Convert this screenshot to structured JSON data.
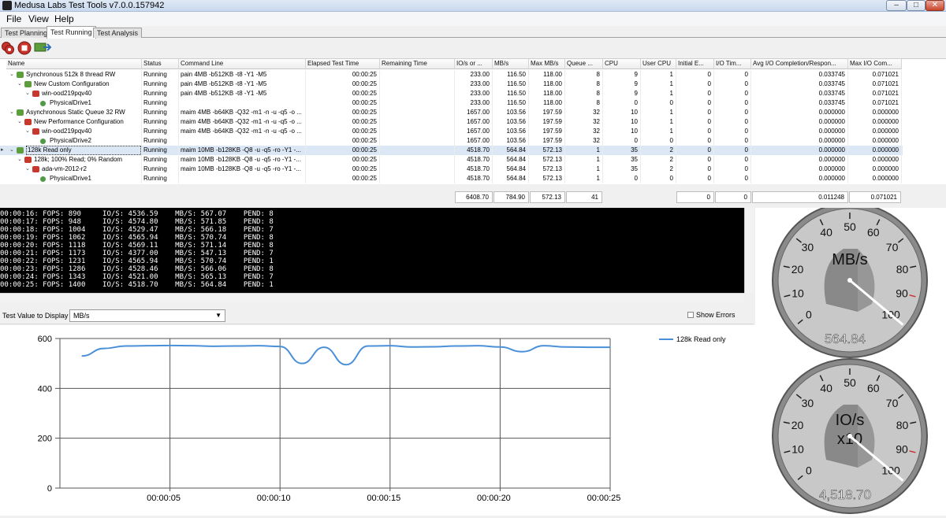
{
  "window": {
    "title": "Medusa Labs Test Tools v7.0.0.157942",
    "minimize": "–",
    "maximize": "□",
    "close": "✕"
  },
  "menu": [
    "File",
    "View",
    "Help"
  ],
  "tabs": [
    "Test Planning",
    "Test Running",
    "Test Analysis"
  ],
  "toolbar": {
    "icons": [
      "run-tests-icon",
      "stop-icon",
      "export-icon"
    ]
  },
  "grid": {
    "columns": [
      "Name",
      "Status",
      "Command Line",
      "Elapsed Test Time",
      "Remaining Time",
      "IO/s or ...",
      "MB/s",
      "Max MB/s",
      "Queue ...",
      "CPU",
      "User CPU",
      "Initial E...",
      "I/O Tim...",
      "Avg I/O Completion/Respon...",
      "Max I/O Com..."
    ],
    "rows": [
      {
        "level": 0,
        "exp": "⌄",
        "icon": "green",
        "name": "Synchronous 512k 8 thread RW",
        "status": "Running",
        "cmd": "pain 4MB -b512KB -t8 -Y1 -M5",
        "elapsed": "00:00:25",
        "remaining": "",
        "ios": "233.00",
        "mbs": "116.50",
        "maxmbs": "118.00",
        "queue": "8",
        "cpu": "9",
        "ucpu": "1",
        "init": "0",
        "iot": "0",
        "avg": "0.033745",
        "max": "0.071021"
      },
      {
        "level": 1,
        "exp": "⌄",
        "icon": "green",
        "name": "New Custom Configuration",
        "status": "Running",
        "cmd": "pain 4MB -b512KB -t8 -Y1 -M5",
        "elapsed": "00:00:25",
        "remaining": "",
        "ios": "233.00",
        "mbs": "116.50",
        "maxmbs": "118.00",
        "queue": "8",
        "cpu": "9",
        "ucpu": "1",
        "init": "0",
        "iot": "0",
        "avg": "0.033745",
        "max": "0.071021"
      },
      {
        "level": 2,
        "exp": "⌄",
        "icon": "red",
        "name": "win-ood219pqv40",
        "status": "Running",
        "cmd": "pain 4MB -b512KB -t8 -Y1 -M5",
        "elapsed": "00:00:25",
        "remaining": "",
        "ios": "233.00",
        "mbs": "116.50",
        "maxmbs": "118.00",
        "queue": "8",
        "cpu": "9",
        "ucpu": "1",
        "init": "0",
        "iot": "0",
        "avg": "0.033745",
        "max": "0.071021"
      },
      {
        "level": 3,
        "exp": "",
        "icon": "drive",
        "name": "PhysicalDrive1",
        "status": "Running",
        "cmd": "",
        "elapsed": "00:00:25",
        "remaining": "",
        "ios": "233.00",
        "mbs": "116.50",
        "maxmbs": "118.00",
        "queue": "8",
        "cpu": "0",
        "ucpu": "0",
        "init": "0",
        "iot": "0",
        "avg": "0.033745",
        "max": "0.071021"
      },
      {
        "level": 0,
        "exp": "⌄",
        "icon": "green",
        "name": "Asynchronous Static Queue 32 RW",
        "status": "Running",
        "cmd": "maim 4MB -b64KB -Q32 -m1 -n -u -q5 -o ...",
        "elapsed": "00:00:25",
        "remaining": "",
        "ios": "1657.00",
        "mbs": "103.56",
        "maxmbs": "197.59",
        "queue": "32",
        "cpu": "10",
        "ucpu": "1",
        "init": "0",
        "iot": "0",
        "avg": "0.000000",
        "max": "0.000000"
      },
      {
        "level": 1,
        "exp": "⌄",
        "icon": "red",
        "name": "New Performance Configuration",
        "status": "Running",
        "cmd": "maim 4MB -b64KB -Q32 -m1 -n -u -q5 -o ...",
        "elapsed": "00:00:25",
        "remaining": "",
        "ios": "1657.00",
        "mbs": "103.56",
        "maxmbs": "197.59",
        "queue": "32",
        "cpu": "10",
        "ucpu": "1",
        "init": "0",
        "iot": "0",
        "avg": "0.000000",
        "max": "0.000000"
      },
      {
        "level": 2,
        "exp": "⌄",
        "icon": "red",
        "name": "win-ood219pqv40",
        "status": "Running",
        "cmd": "maim 4MB -b64KB -Q32 -m1 -n -u -q5 -o ...",
        "elapsed": "00:00:25",
        "remaining": "",
        "ios": "1657.00",
        "mbs": "103.56",
        "maxmbs": "197.59",
        "queue": "32",
        "cpu": "10",
        "ucpu": "1",
        "init": "0",
        "iot": "0",
        "avg": "0.000000",
        "max": "0.000000"
      },
      {
        "level": 3,
        "exp": "",
        "icon": "drive",
        "name": "PhysicalDrive2",
        "status": "Running",
        "cmd": "",
        "elapsed": "00:00:25",
        "remaining": "",
        "ios": "1657.00",
        "mbs": "103.56",
        "maxmbs": "197.59",
        "queue": "32",
        "cpu": "0",
        "ucpu": "0",
        "init": "0",
        "iot": "0",
        "avg": "0.000000",
        "max": "0.000000"
      },
      {
        "level": 0,
        "exp": "⌄",
        "icon": "green",
        "name": "128k Read only",
        "status": "Running",
        "cmd": "maim 10MB -b128KB -Q8 -u -q5 -ro -Y1 -...",
        "elapsed": "00:00:25",
        "remaining": "",
        "ios": "4518.70",
        "mbs": "564.84",
        "maxmbs": "572.13",
        "queue": "1",
        "cpu": "35",
        "ucpu": "2",
        "init": "0",
        "iot": "0",
        "avg": "0.000000",
        "max": "0.000000",
        "selected": true
      },
      {
        "level": 1,
        "exp": "⌄",
        "icon": "red",
        "name": "128k; 100% Read; 0% Random",
        "status": "Running",
        "cmd": "maim 10MB -b128KB -Q8 -u -q5 -ro -Y1 -...",
        "elapsed": "00:00:25",
        "remaining": "",
        "ios": "4518.70",
        "mbs": "564.84",
        "maxmbs": "572.13",
        "queue": "1",
        "cpu": "35",
        "ucpu": "2",
        "init": "0",
        "iot": "0",
        "avg": "0.000000",
        "max": "0.000000"
      },
      {
        "level": 2,
        "exp": "⌄",
        "icon": "red",
        "name": "ada-vm-2012-r2",
        "status": "Running",
        "cmd": "maim 10MB -b128KB -Q8 -u -q5 -ro -Y1 -...",
        "elapsed": "00:00:25",
        "remaining": "",
        "ios": "4518.70",
        "mbs": "564.84",
        "maxmbs": "572.13",
        "queue": "1",
        "cpu": "35",
        "ucpu": "2",
        "init": "0",
        "iot": "0",
        "avg": "0.000000",
        "max": "0.000000"
      },
      {
        "level": 3,
        "exp": "",
        "icon": "drive",
        "name": "PhysicalDrive1",
        "status": "Running",
        "cmd": "",
        "elapsed": "00:00:25",
        "remaining": "",
        "ios": "4518.70",
        "mbs": "564.84",
        "maxmbs": "572.13",
        "queue": "1",
        "cpu": "0",
        "ucpu": "0",
        "init": "0",
        "iot": "0",
        "avg": "0.000000",
        "max": "0.000000"
      }
    ],
    "totals": {
      "ios": "6408.70",
      "mbs": "784.90",
      "maxmbs": "572.13",
      "queue": "41",
      "init": "0",
      "iot": "0",
      "avg": "0.011248",
      "max": "0.071021"
    }
  },
  "console": {
    "lines": [
      "00:00:16: FOPS: 890     IO/S: 4536.59    MB/S: 567.07    PEND: 8",
      "00:00:17: FOPS: 948     IO/S: 4574.80    MB/S: 571.85    PEND: 8",
      "00:00:18: FOPS: 1004    IO/S: 4529.47    MB/S: 566.18    PEND: 7",
      "00:00:19: FOPS: 1062    IO/S: 4565.94    MB/S: 570.74    PEND: 8",
      "00:00:20: FOPS: 1118    IO/S: 4569.11    MB/S: 571.14    PEND: 8",
      "00:00:21: FOPS: 1173    IO/S: 4377.00    MB/S: 547.13    PEND: 7",
      "00:00:22: FOPS: 1231    IO/S: 4565.94    MB/S: 570.74    PEND: 1",
      "00:00:23: FOPS: 1286    IO/S: 4528.46    MB/S: 566.06    PEND: 8",
      "00:00:24: FOPS: 1343    IO/S: 4521.00    MB/S: 565.13    PEND: 7",
      "00:00:25: FOPS: 1400    IO/S: 4518.70    MB/S: 564.84    PEND: 1"
    ]
  },
  "display": {
    "label": "Test Value to Display",
    "selected": "MB/s",
    "show_errors": "Show Errors"
  },
  "chart_data": {
    "type": "line",
    "title": "",
    "xlabel": "",
    "ylabel": "",
    "ylim": [
      0,
      600
    ],
    "yticks": [
      "0",
      "200",
      "400",
      "600"
    ],
    "xticks": [
      "00:00:05",
      "00:00:10",
      "00:00:15",
      "00:00:20",
      "00:00:25"
    ],
    "xtick_seconds": [
      5,
      10,
      15,
      20,
      25
    ],
    "xlim": [
      0,
      25
    ],
    "legend_position": "top-right",
    "grid": true,
    "series": [
      {
        "name": "128k Read only",
        "color": "#4a90d9",
        "x": [
          1,
          2,
          3,
          4,
          5,
          6,
          7,
          8,
          9,
          10,
          11,
          12,
          13,
          14,
          15,
          16,
          17,
          18,
          19,
          20,
          21,
          22,
          23,
          24,
          25
        ],
        "y": [
          530,
          560,
          570,
          571,
          572,
          571,
          569,
          570,
          571,
          568,
          500,
          565,
          495,
          570,
          571,
          566,
          567,
          570,
          571,
          566,
          547,
          571,
          566,
          565,
          565
        ]
      }
    ]
  },
  "gauges": [
    {
      "title": "MB/s",
      "subtitle": "",
      "value_text": "564.84",
      "ticks": [
        "0",
        "10",
        "20",
        "30",
        "40",
        "50",
        "60",
        "70",
        "80",
        "90",
        "100"
      ],
      "value": 100
    },
    {
      "title": "IO/s",
      "subtitle": "x10",
      "value_text": "4,518.70",
      "ticks": [
        "0",
        "10",
        "20",
        "30",
        "40",
        "50",
        "60",
        "70",
        "80",
        "90",
        "100"
      ],
      "value": 100
    }
  ]
}
